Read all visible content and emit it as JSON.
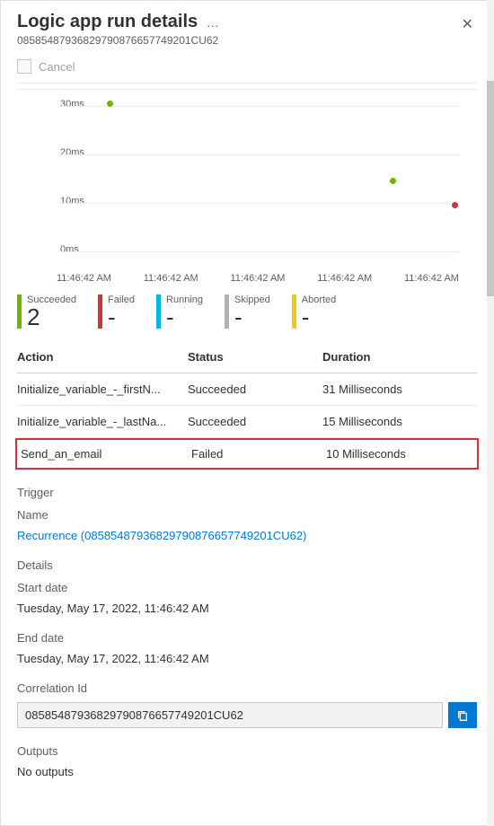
{
  "header": {
    "title": "Logic app run details",
    "run_id": "08585487936829790876657749201CU62",
    "more": "…",
    "close": "✕"
  },
  "toolbar": {
    "cancel_label": "Cancel"
  },
  "chart_data": {
    "type": "scatter",
    "xlabel": "",
    "ylabel": "",
    "ylim": [
      0,
      35
    ],
    "y_ticks": [
      "0ms",
      "10ms",
      "20ms",
      "30ms"
    ],
    "x_ticks": [
      "11:46:42 AM",
      "11:46:42 AM",
      "11:46:42 AM",
      "11:46:42 AM",
      "11:46:42 AM"
    ],
    "series": [
      {
        "name": "Succeeded",
        "color": "#6bb700",
        "points": [
          {
            "x": 0.06,
            "y": 31
          },
          {
            "x": 0.78,
            "y": 15
          }
        ]
      },
      {
        "name": "Failed",
        "color": "#d13438",
        "points": [
          {
            "x": 0.93,
            "y": 10
          }
        ]
      }
    ]
  },
  "stats": [
    {
      "label": "Succeeded",
      "value": "2",
      "color": "#6bb700"
    },
    {
      "label": "Failed",
      "value": "-",
      "color": "#d13438"
    },
    {
      "label": "Running",
      "value": "-",
      "color": "#00b7e0"
    },
    {
      "label": "Skipped",
      "value": "-",
      "color": "#b3b0ad"
    },
    {
      "label": "Aborted",
      "value": "-",
      "color": "#f2c811"
    }
  ],
  "table": {
    "headers": {
      "action": "Action",
      "status": "Status",
      "duration": "Duration"
    },
    "rows": [
      {
        "action": "Initialize_variable_-_firstN...",
        "status": "Succeeded",
        "duration": "31 Milliseconds",
        "highlight": false
      },
      {
        "action": "Initialize_variable_-_lastNa...",
        "status": "Succeeded",
        "duration": "15 Milliseconds",
        "highlight": false
      },
      {
        "action": "Send_an_email",
        "status": "Failed",
        "duration": "10 Milliseconds",
        "highlight": true
      }
    ]
  },
  "trigger": {
    "section": "Trigger",
    "name_label": "Name",
    "name_link": "Recurrence (08585487936829790876657749201CU62)"
  },
  "details": {
    "section": "Details",
    "start_label": "Start date",
    "start_val": "Tuesday, May 17, 2022, 11:46:42 AM",
    "end_label": "End date",
    "end_val": "Tuesday, May 17, 2022, 11:46:42 AM",
    "corr_label": "Correlation Id",
    "corr_val": "08585487936829790876657749201CU62"
  },
  "outputs": {
    "section": "Outputs",
    "value": "No outputs"
  }
}
